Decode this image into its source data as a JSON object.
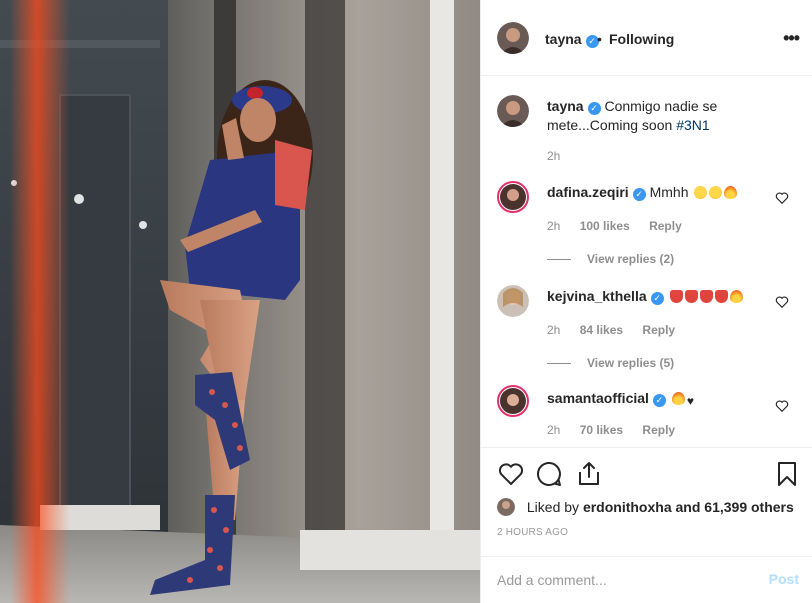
{
  "header": {
    "username": "tayna",
    "verified_glyph": "✓",
    "separator": "•",
    "follow_status": "Following",
    "more_label": "•••"
  },
  "caption": {
    "username": "tayna",
    "text": "Conmigo nadie se mete...Coming soon",
    "hashtag": "#3N1",
    "time": "2h"
  },
  "comments": [
    {
      "username": "dafina.zeqiri",
      "text": "Mmhh",
      "emojis": [
        "star-struck",
        "star-struck",
        "fire"
      ],
      "time": "2h",
      "likes": "100 likes",
      "reply": "Reply",
      "view_replies": "View replies (2)"
    },
    {
      "username": "kejvina_kthella",
      "text": "",
      "emojis": [
        "tongue",
        "tongue",
        "tongue",
        "tongue",
        "fire"
      ],
      "time": "2h",
      "likes": "84 likes",
      "reply": "Reply",
      "view_replies": "View replies (5)"
    },
    {
      "username": "samantaofficial",
      "text": "",
      "emojis": [
        "fire",
        "black-heart"
      ],
      "time": "2h",
      "likes": "70 likes",
      "reply": "Reply"
    }
  ],
  "actions": {
    "liked_by_prefix": "Liked by",
    "liked_by_user": "erdonithoxha",
    "liked_by_suffix": "and 61,399 others",
    "timestamp": "2 HOURS AGO"
  },
  "add_comment": {
    "placeholder": "Add a comment...",
    "post_label": "Post"
  },
  "icons": {
    "like": "heart-icon",
    "comment": "comment-icon",
    "share": "share-icon",
    "save": "bookmark-icon"
  },
  "colors": {
    "verified": "#3897f0",
    "hashtag": "#003569",
    "post_disabled": "#b2dffc",
    "muted": "#8e8e8e"
  }
}
